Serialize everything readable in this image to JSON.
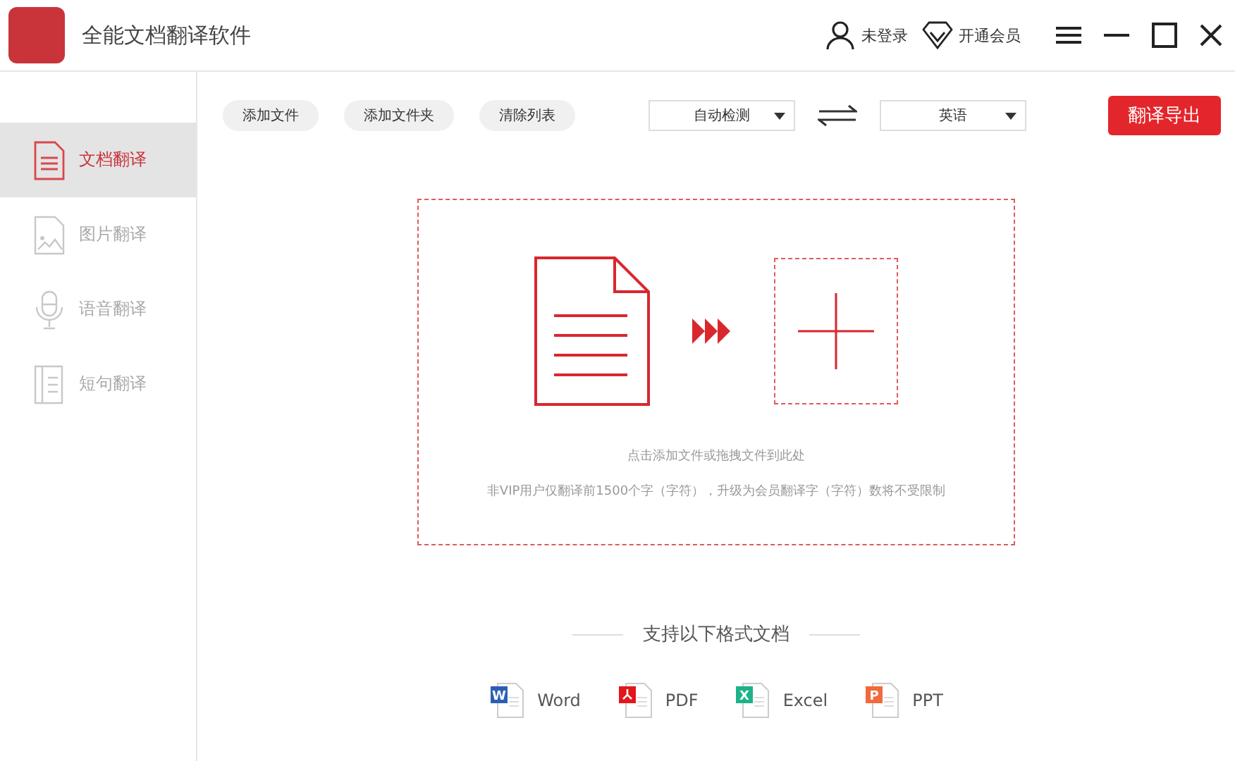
{
  "window": {
    "title": "全能文档翻译软件"
  },
  "account": {
    "login": "未登录",
    "vip": "开通会员"
  },
  "sidebar": {
    "items": [
      {
        "label": "文档翻译",
        "kind": "document",
        "selected": true
      },
      {
        "label": "图片翻译",
        "kind": "image",
        "selected": false
      },
      {
        "label": "语音翻译",
        "kind": "voice",
        "selected": false
      },
      {
        "label": "短句翻译",
        "kind": "sentence",
        "selected": false
      }
    ]
  },
  "toolbar": {
    "buttons": [
      "添加文件",
      "添加文件夹",
      "清除列表"
    ],
    "source_language": "自动检测",
    "target_language": "英语",
    "export_button": "翻译导出"
  },
  "drop_zone": {
    "hint": "点击添加文件或拖拽文件到此处",
    "notice": "非VIP用户仅翻译前1500个字（字符），升级为会员翻译字（字符）数将不受限制"
  },
  "formats": {
    "title": "支持以下格式文档",
    "items": [
      {
        "kind": "word",
        "letter": "W",
        "label": "Word"
      },
      {
        "kind": "pdf",
        "label": "PDF"
      },
      {
        "kind": "excel",
        "letter": "X",
        "label": "Excel"
      },
      {
        "kind": "ppt",
        "letter": "P",
        "label": "PPT"
      }
    ]
  }
}
